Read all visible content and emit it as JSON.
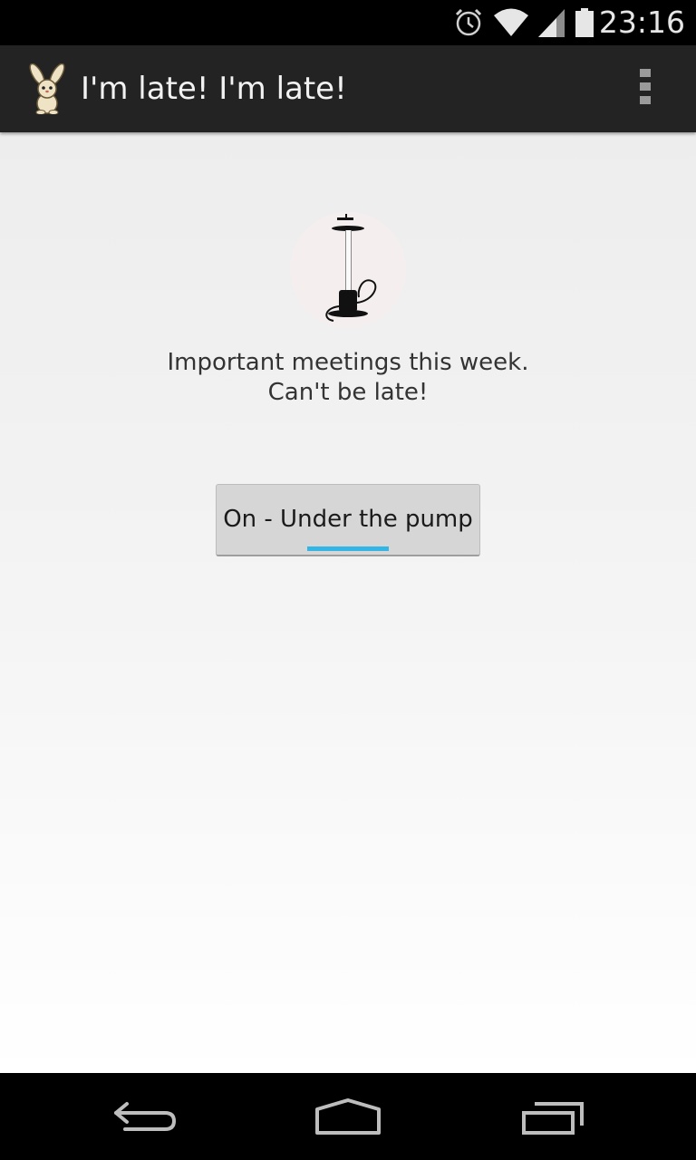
{
  "status_bar": {
    "time": "23:16",
    "icons": [
      "alarm-icon",
      "wifi-icon",
      "signal-icon",
      "battery-icon"
    ]
  },
  "action_bar": {
    "title": "I'm late! I'm late!",
    "app_icon": "rabbit-icon",
    "menu_icon": "overflow-menu-icon"
  },
  "main": {
    "hero_icon": "pump-icon",
    "message_line1": "Important meetings this week.",
    "message_line2": "Can't be late!",
    "toggle_label": "On - Under the pump",
    "toggle_state": "on"
  },
  "nav_bar": {
    "icons": [
      "back-icon",
      "home-icon",
      "recent-apps-icon"
    ]
  },
  "colors": {
    "accent": "#33b5e5",
    "action_bar": "#232323",
    "button": "#d6d6d6"
  }
}
